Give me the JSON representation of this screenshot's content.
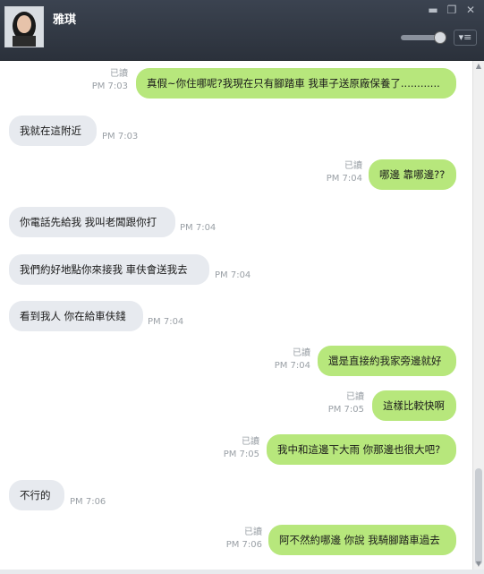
{
  "header": {
    "contact_name": "雅琪",
    "window_controls": {
      "minimize": "▬",
      "maximize": "❐",
      "close": "✕"
    },
    "volume_level": 0.9,
    "menu_icon": "▾≡"
  },
  "messages": [
    {
      "direction": "out",
      "text": "真假~你住哪呢?我現在只有腳踏車 我車子送原廠保養了............",
      "read": "已讀",
      "time": "PM 7:03"
    },
    {
      "direction": "in",
      "text": "我就在這附近",
      "time": "PM 7:03"
    },
    {
      "direction": "out",
      "text": "哪邊 靠哪邊??",
      "read": "已讀",
      "time": "PM 7:04"
    },
    {
      "direction": "in",
      "text": "你電話先給我 我叫老闆跟你打",
      "time": "PM 7:04"
    },
    {
      "direction": "in",
      "text": "我們約好地點你來接我  車伕會送我去",
      "time": "PM 7:04"
    },
    {
      "direction": "in",
      "text": "看到我人 你在給車伕錢",
      "time": "PM 7:04"
    },
    {
      "direction": "out",
      "text": "還是直接約我家旁邊就好",
      "read": "已讀",
      "time": "PM 7:04"
    },
    {
      "direction": "out",
      "text": "這樣比較快啊",
      "read": "已讀",
      "time": "PM 7:05"
    },
    {
      "direction": "out",
      "text": "我中和這邊下大雨 你那邊也很大吧?",
      "read": "已讀",
      "time": "PM 7:05"
    },
    {
      "direction": "in",
      "text": "不行的",
      "time": "PM 7:06"
    },
    {
      "direction": "out",
      "text": "阿不然約哪邊 你說 我騎腳踏車過去",
      "read": "已讀",
      "time": "PM 7:06"
    }
  ],
  "colors": {
    "outgoing_bubble": "#b7e77c",
    "incoming_bubble": "#e7eaef",
    "header_bg": "#2f353f"
  }
}
